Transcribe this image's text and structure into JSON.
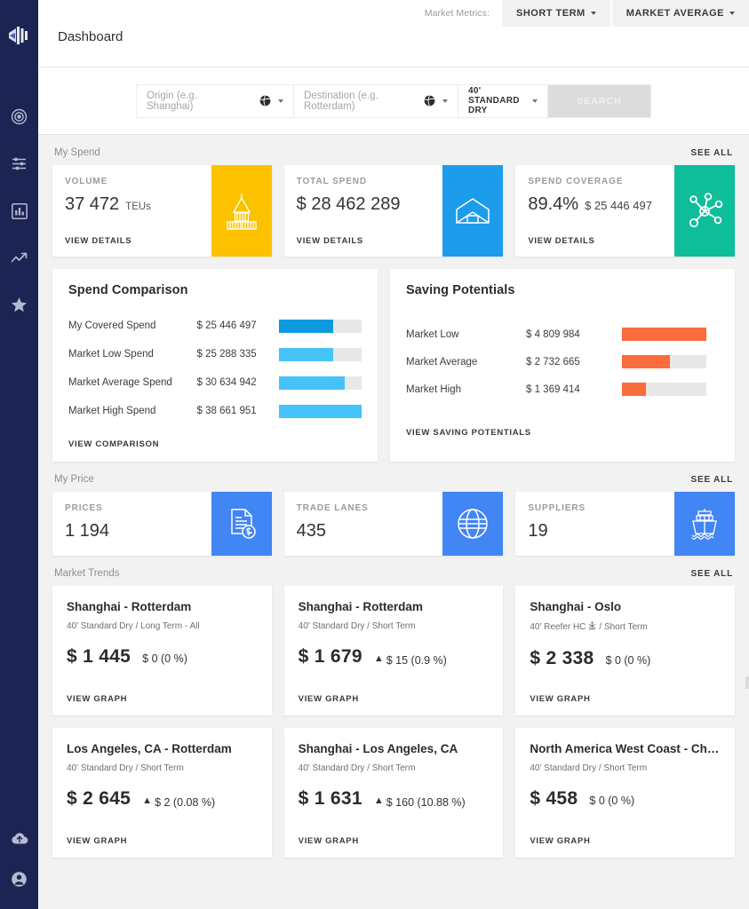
{
  "sidebar": {
    "logo_icon": "fleet-logo-icon",
    "items": [
      {
        "icon": "target-icon",
        "name": "sidebar-item-target"
      },
      {
        "icon": "sliders-icon",
        "name": "sidebar-item-filters"
      },
      {
        "icon": "bar-chart-icon",
        "name": "sidebar-item-reports"
      },
      {
        "icon": "trending-up-icon",
        "name": "sidebar-item-trends"
      },
      {
        "icon": "star-icon",
        "name": "sidebar-item-favorites"
      }
    ],
    "bottom_items": [
      {
        "icon": "cloud-upload-icon",
        "name": "sidebar-item-upload"
      },
      {
        "icon": "user-account-icon",
        "name": "sidebar-item-account"
      }
    ]
  },
  "header": {
    "title": "Dashboard",
    "market_metrics_label": "Market Metrics:",
    "term_button": "SHORT TERM",
    "average_button": "MARKET AVERAGE"
  },
  "search": {
    "origin_placeholder": "Origin (e.g. Shanghai)",
    "destination_placeholder": "Destination (e.g. Rotterdam)",
    "container_type": "40' STANDARD DRY",
    "search_button": "SEARCH"
  },
  "my_spend": {
    "section_title": "My Spend",
    "see_all": "SEE ALL",
    "cards": [
      {
        "label": "VOLUME",
        "value": "37 472",
        "unit": "TEUs",
        "sub": "",
        "link": "VIEW DETAILS",
        "color": "#fcc200",
        "icon": "containers-icon"
      },
      {
        "label": "TOTAL SPEND",
        "value": "$ 28 462 289",
        "unit": "",
        "sub": "",
        "link": "VIEW DETAILS",
        "color": "#1d9ceb",
        "icon": "shipping-box-icon"
      },
      {
        "label": "SPEND COVERAGE",
        "value": "89.4%",
        "unit": "",
        "sub": "$ 25 446 497",
        "link": "VIEW DETAILS",
        "color": "#0ebd9a",
        "icon": "network-nodes-icon"
      }
    ]
  },
  "spend_comparison": {
    "title": "Spend Comparison",
    "link": "VIEW COMPARISON",
    "rows": [
      {
        "name": "My Covered Spend",
        "amount": "$ 25 446 497",
        "pct": 66,
        "color": "#0d9ae0"
      },
      {
        "name": "Market Low Spend",
        "amount": "$ 25 288 335",
        "pct": 65,
        "color": "#45c2f7"
      },
      {
        "name": "Market Average Spend",
        "amount": "$ 30 634 942",
        "pct": 79,
        "color": "#45c2f7"
      },
      {
        "name": "Market High Spend",
        "amount": "$ 38 661 951",
        "pct": 100,
        "color": "#45c2f7"
      }
    ]
  },
  "saving_potentials": {
    "title": "Saving Potentials",
    "link": "VIEW SAVING POTENTIALS",
    "rows": [
      {
        "name": "Market Low",
        "amount": "$ 4 809 984",
        "pct": 100,
        "color": "#fb6c3b"
      },
      {
        "name": "Market Average",
        "amount": "$ 2 732 665",
        "pct": 57,
        "color": "#fb6c3b"
      },
      {
        "name": "Market High",
        "amount": "$ 1 369 414",
        "pct": 28,
        "color": "#fb6c3b"
      }
    ]
  },
  "my_price": {
    "section_title": "My Price",
    "see_all": "SEE ALL",
    "cards": [
      {
        "label": "PRICES",
        "value": "1 194",
        "link": "",
        "color": "#4285f4",
        "icon": "price-document-icon"
      },
      {
        "label": "TRADE LANES",
        "value": "435",
        "link": "",
        "color": "#4285f4",
        "icon": "globe-grid-icon"
      },
      {
        "label": "SUPPLIERS",
        "value": "19",
        "link": "",
        "color": "#4285f4",
        "icon": "cargo-ship-icon"
      }
    ]
  },
  "market_trends": {
    "section_title": "Market Trends",
    "see_all": "SEE ALL",
    "cards": [
      {
        "route": "Shanghai - Rotterdam",
        "meta": "40' Standard Dry / Long Term - All",
        "reefer": false,
        "price": "$ 1 445",
        "delta": "$ 0 (0 %)",
        "up": false,
        "link": "VIEW GRAPH"
      },
      {
        "route": "Shanghai - Rotterdam",
        "meta": "40' Standard Dry / Short Term",
        "reefer": false,
        "price": "$ 1 679",
        "delta": "$ 15 (0.9 %)",
        "up": true,
        "link": "VIEW GRAPH"
      },
      {
        "route": "Shanghai - Oslo",
        "meta_pre": "40' Reefer HC",
        "meta_post": "/ Short Term",
        "meta": "40' Reefer HC  / Short Term",
        "reefer": true,
        "price": "$ 2 338",
        "delta": "$ 0 (0 %)",
        "up": false,
        "link": "VIEW GRAPH"
      },
      {
        "route": "Los Angeles, CA - Rotterdam",
        "meta": "40' Standard Dry / Short Term",
        "reefer": false,
        "price": "$ 2 645",
        "delta": "$ 2 (0.08 %)",
        "up": true,
        "link": "VIEW GRAPH"
      },
      {
        "route": "Shanghai - Los Angeles, CA",
        "meta": "40' Standard Dry / Short Term",
        "reefer": false,
        "price": "$ 1 631",
        "delta": "$ 160 (10.88 %)",
        "up": true,
        "link": "VIEW GRAPH"
      },
      {
        "route": "North America West Coast - China…",
        "meta": "40' Standard Dry / Short Term",
        "reefer": false,
        "price": "$ 458",
        "delta": "$ 0 (0 %)",
        "up": false,
        "link": "VIEW GRAPH"
      }
    ]
  }
}
